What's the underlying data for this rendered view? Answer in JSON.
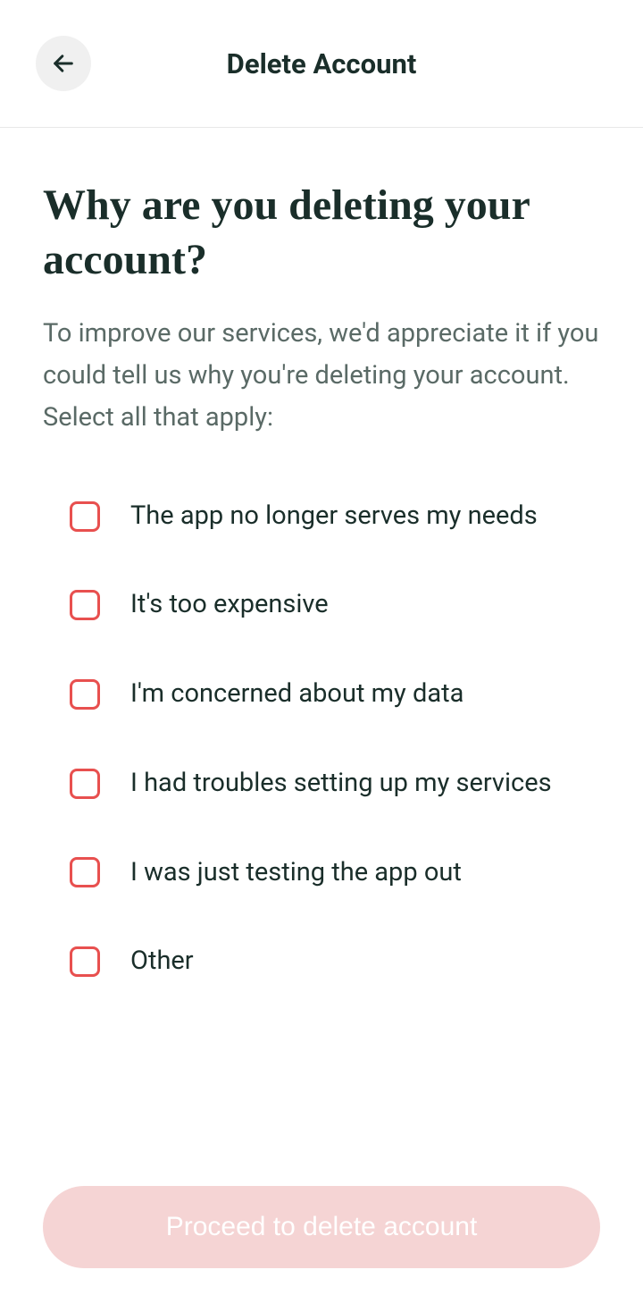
{
  "header": {
    "title": "Delete Account"
  },
  "main": {
    "question_title": "Why are you deleting your account?",
    "question_subtitle": "To improve our services, we'd appreciate it if you could tell us why you're deleting your account. Select all that apply:",
    "reasons": [
      "The app no longer serves my needs",
      "It's too expensive",
      "I'm concerned about my data",
      "I had troubles setting up my services",
      "I was just testing the app out",
      "Other"
    ]
  },
  "footer": {
    "proceed_label": "Proceed to delete account"
  }
}
